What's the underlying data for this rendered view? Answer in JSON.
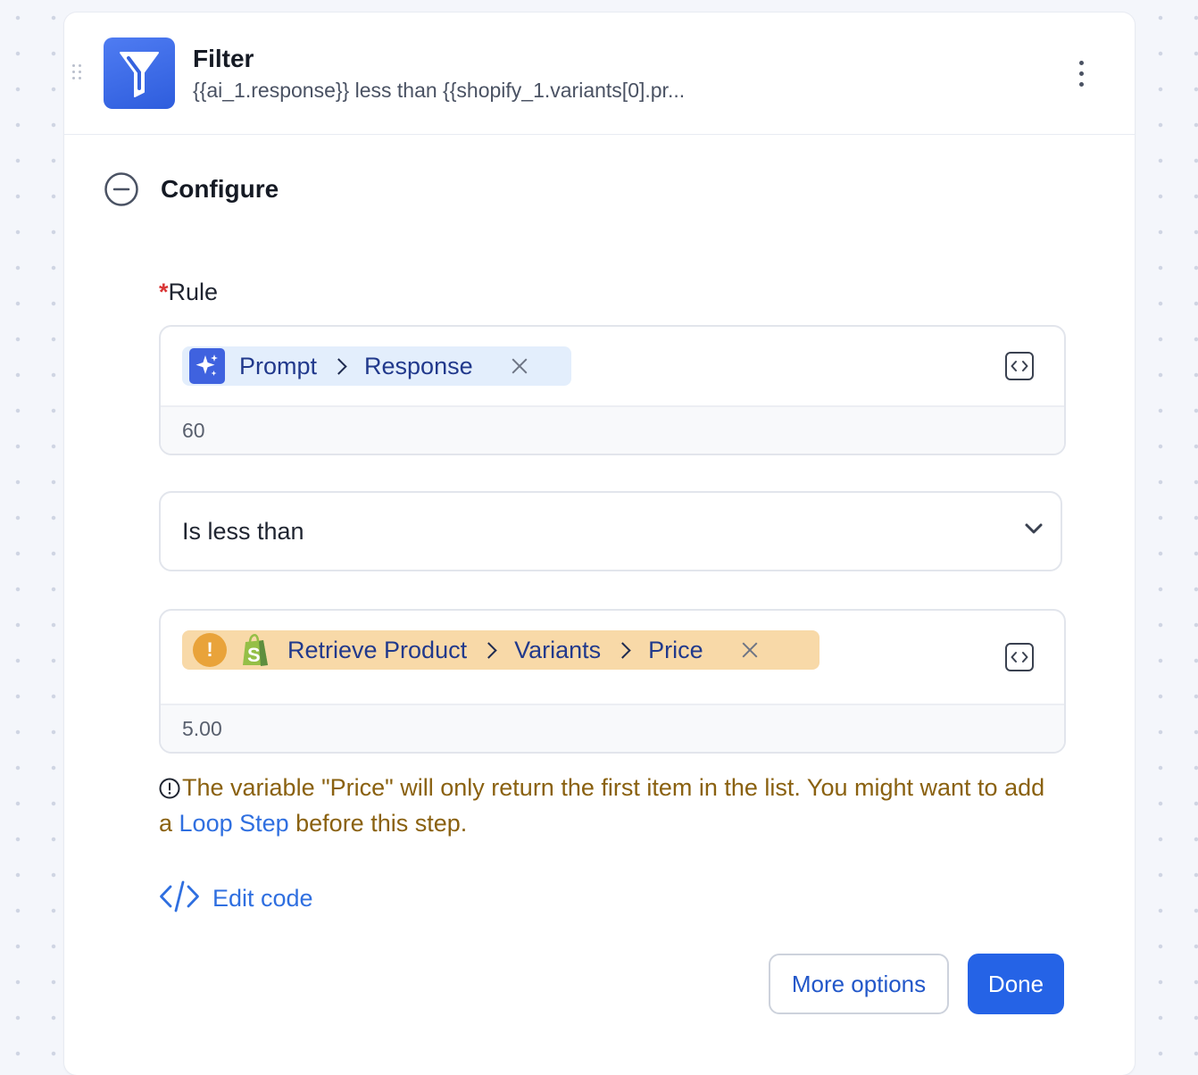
{
  "step": {
    "title": "Filter",
    "subtitle": "{{ai_1.response}} less than {{shopify_1.variants[0].pr...",
    "icon": "funnel-icon",
    "accent_color": "#3b6ef0"
  },
  "section": {
    "title": "Configure"
  },
  "rule": {
    "required_marker": "*",
    "label": "Rule",
    "first_value": {
      "crumbs": [
        "Prompt",
        "Response"
      ],
      "icon": "sparkle-icon",
      "pill_color": "#e3eefc",
      "preview": "60"
    },
    "operator": {
      "selected": "Is less than"
    },
    "second_value": {
      "crumbs": [
        "Retrieve Product",
        "Variants",
        "Price"
      ],
      "icon": "shopify-icon",
      "pill_color": "#f8d9a8",
      "preview": "5.00"
    }
  },
  "warning": {
    "prefix": "The variable \"Price\" will only return the first item in the list. You might want to add a ",
    "link": "Loop Step",
    "suffix": " before this step.",
    "color": "#8a6110"
  },
  "edit_code": {
    "label": "Edit code"
  },
  "buttons": {
    "more_options": "More options",
    "done": "Done",
    "primary_color": "#2563e6"
  }
}
